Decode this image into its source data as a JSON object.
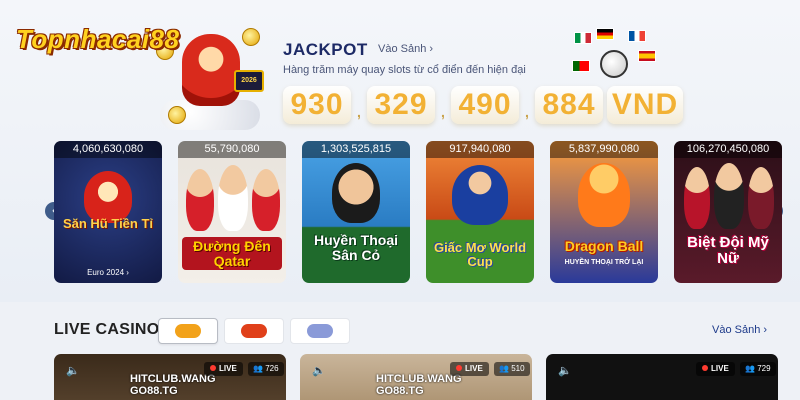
{
  "watermark": {
    "logo_text": "Topnhacai88"
  },
  "jackpot": {
    "title": "JACKPOT",
    "lobby_link": "Vào Sảnh",
    "subtitle": "Hàng trăm máy quay slots từ cổ điển đến hiện đại",
    "digit_groups": [
      "930",
      "329",
      "490",
      "884"
    ],
    "separator": ",",
    "currency": "VND",
    "badge_year": "2026"
  },
  "slots": {
    "prev_icon": "chevron-left-icon",
    "next_icon": "chevron-right-icon",
    "cards": [
      {
        "amount": "4,060,630,080",
        "title": "Săn Hũ Tiền Tỉ",
        "footer": "Euro 2024 ›",
        "accent": "#ffd24a"
      },
      {
        "amount": "55,790,080",
        "title": "Đường Đến Qatar",
        "accent": "#ffd200"
      },
      {
        "amount": "1,303,525,815",
        "title": "Huyền Thoại Sân Cỏ",
        "accent": "#ffffff"
      },
      {
        "amount": "917,940,080",
        "title": "Giấc Mơ World Cup",
        "accent": "#ffe14a"
      },
      {
        "amount": "5,837,990,080",
        "title": "Dragon Ball",
        "subtitle": "HUYỀN THOẠI TRỞ LẠI",
        "accent": "#ffcc22"
      },
      {
        "amount": "106,270,450,080",
        "title": "Biệt Đội Mỹ Nữ",
        "accent": "#ffffff"
      }
    ]
  },
  "live_casino": {
    "title": "LIVE CASINO",
    "lobby_link": "Vào Sảnh",
    "tabs": [
      {
        "label": "",
        "color": "#f2a21a"
      },
      {
        "label": "",
        "color": "#e0401a"
      },
      {
        "label": "",
        "color": "#8a9ad8"
      }
    ],
    "tables": [
      {
        "live": "LIVE",
        "viewers": "726",
        "watermark": [
          "HITCLUB.WANG",
          "GO88.TG"
        ]
      },
      {
        "live": "LIVE",
        "viewers": "510",
        "watermark": [
          "HITCLUB.WANG",
          "GO88.TG"
        ]
      },
      {
        "live": "LIVE",
        "viewers": "729",
        "watermark": []
      }
    ]
  }
}
